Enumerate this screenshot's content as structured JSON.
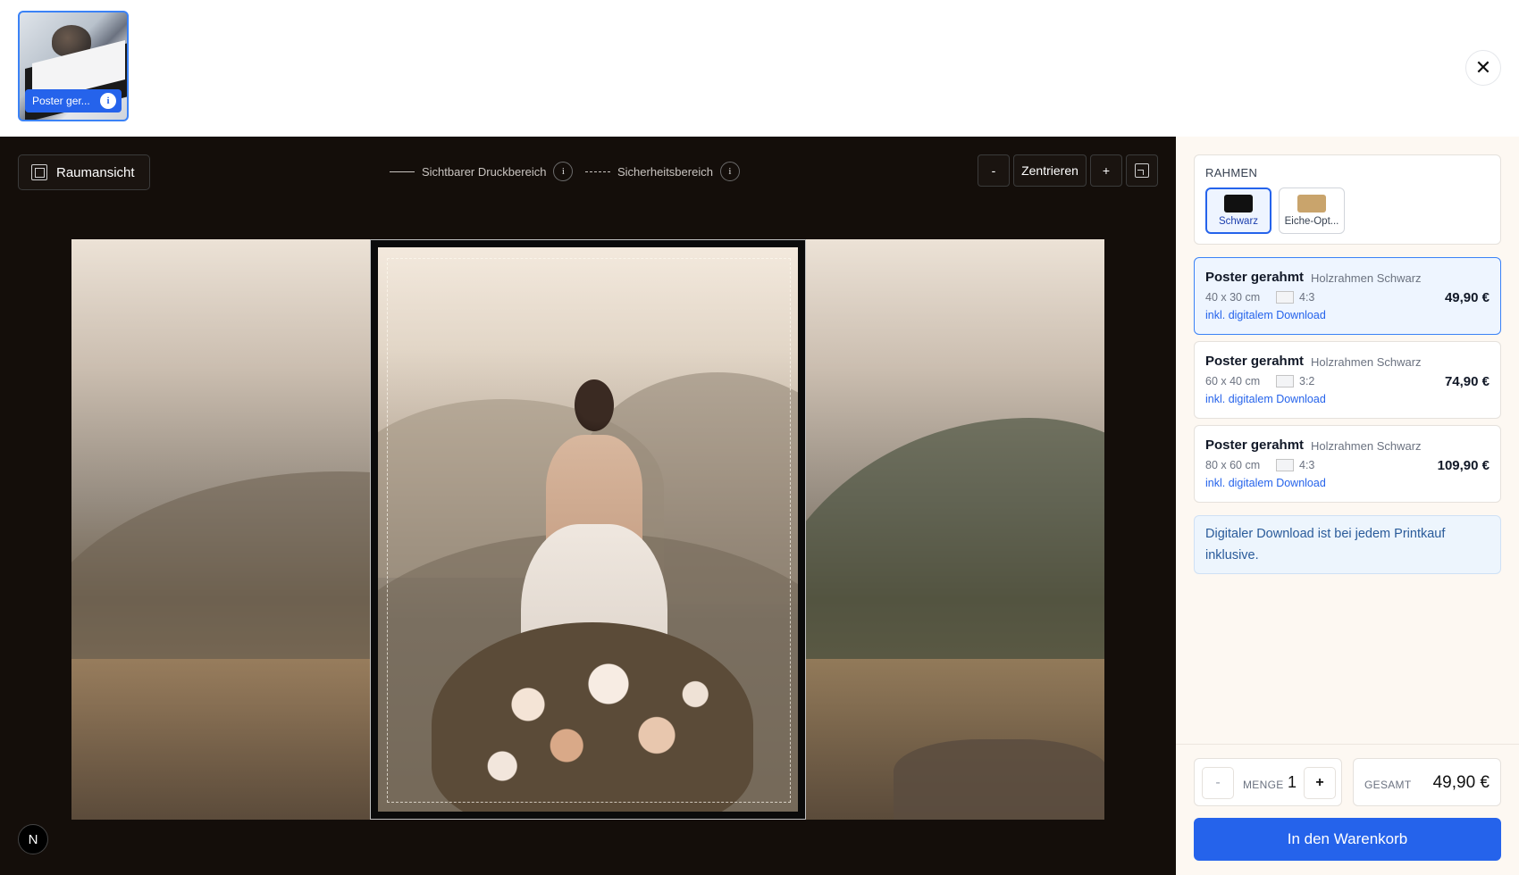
{
  "header": {
    "thumbnail_label": "Poster ger...",
    "thumbnail_info_glyph": "i",
    "close_glyph": "✕"
  },
  "toolbar": {
    "room_view_label": "Raumansicht",
    "legend_visible_label": "Sichtbarer Druckbereich",
    "legend_safe_label": "Sicherheitsbereich",
    "info_glyph": "i",
    "zoom_out_label": "-",
    "center_label": "Zentrieren",
    "zoom_in_label": "+"
  },
  "canvas": {
    "avatar_letter": "N"
  },
  "panel": {
    "frame_title": "RAHMEN",
    "frames": [
      {
        "label": "Schwarz",
        "color": "#111111",
        "active": true
      },
      {
        "label": "Eiche-Opt...",
        "color": "#c9a46c",
        "active": false
      }
    ],
    "offers": [
      {
        "name": "Poster gerahmt",
        "sub": "Holzrahmen Schwarz",
        "size": "40 x 30 cm",
        "ratio": "4:3",
        "download": "inkl. digitalem Download",
        "price": "49,90 €"
      },
      {
        "name": "Poster gerahmt",
        "sub": "Holzrahmen Schwarz",
        "size": "60 x 40 cm",
        "ratio": "3:2",
        "download": "inkl. digitalem Download",
        "price": "74,90 €"
      },
      {
        "name": "Poster gerahmt",
        "sub": "Holzrahmen Schwarz",
        "size": "80 x 60 cm",
        "ratio": "4:3",
        "download": "inkl. digitalem Download",
        "price": "109,90 €"
      }
    ],
    "note": "Digitaler Download ist bei jedem Printkauf inklusive.",
    "quantity": {
      "minus": "-",
      "label": "MENGE",
      "value": "1",
      "plus": "+"
    },
    "total": {
      "label": "GESAMT",
      "value": "49,90 €"
    },
    "cart_button": "In den Warenkorb"
  },
  "colors": {
    "accent": "#2563eb",
    "stage_bg": "#140e0a",
    "panel_bg": "#fdf8f2"
  }
}
